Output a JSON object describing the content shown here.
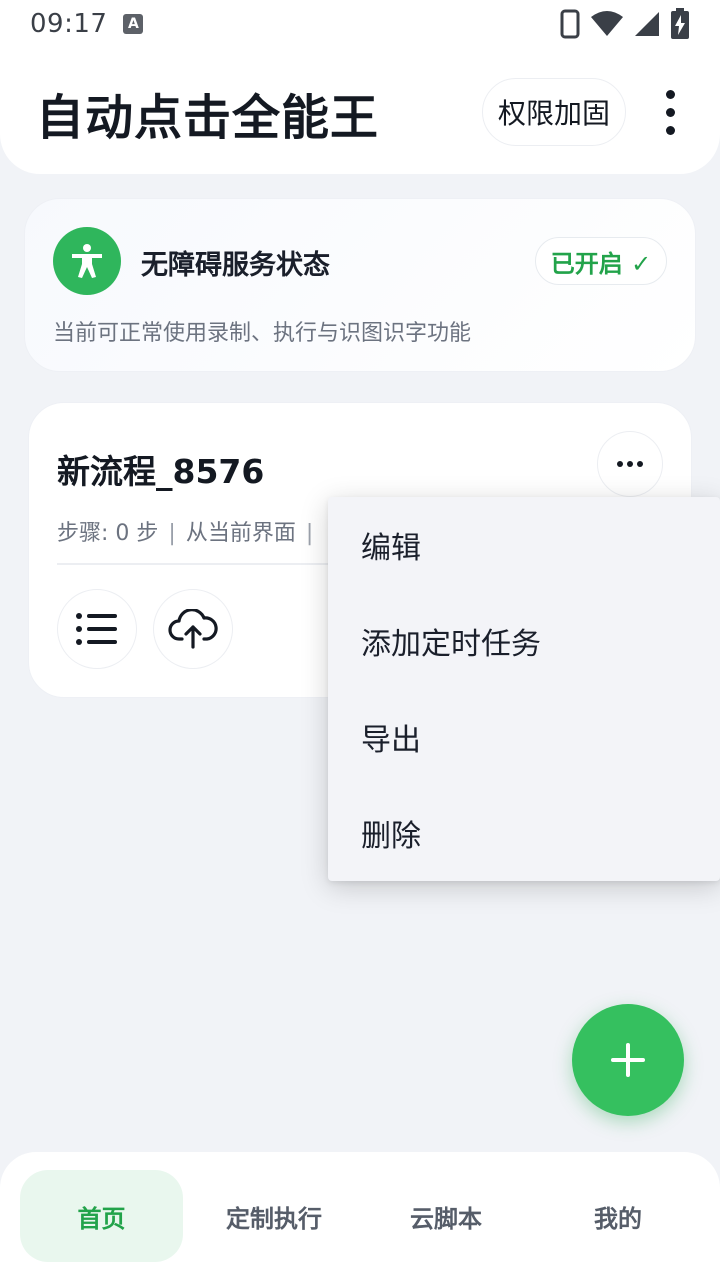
{
  "status_bar": {
    "time": "09:17",
    "a_icon_letter": "A"
  },
  "header": {
    "title": "自动点击全能王",
    "permission_button": "权限加固"
  },
  "accessibility": {
    "title": "无障碍服务状态",
    "badge": "已开启 ✓",
    "description": "当前可正常使用录制、执行与识图识字功能",
    "accent_color": "#2fb65c"
  },
  "flow": {
    "title": "新流程_8576",
    "steps": "步骤: 0 步",
    "source": "从当前界面",
    "separator": "|"
  },
  "popup_menu": {
    "items": [
      "编辑",
      "添加定时任务",
      "导出",
      "删除"
    ]
  },
  "bottom_nav": {
    "items": [
      "首页",
      "定制执行",
      "云脚本",
      "我的"
    ],
    "active_index": 0
  }
}
